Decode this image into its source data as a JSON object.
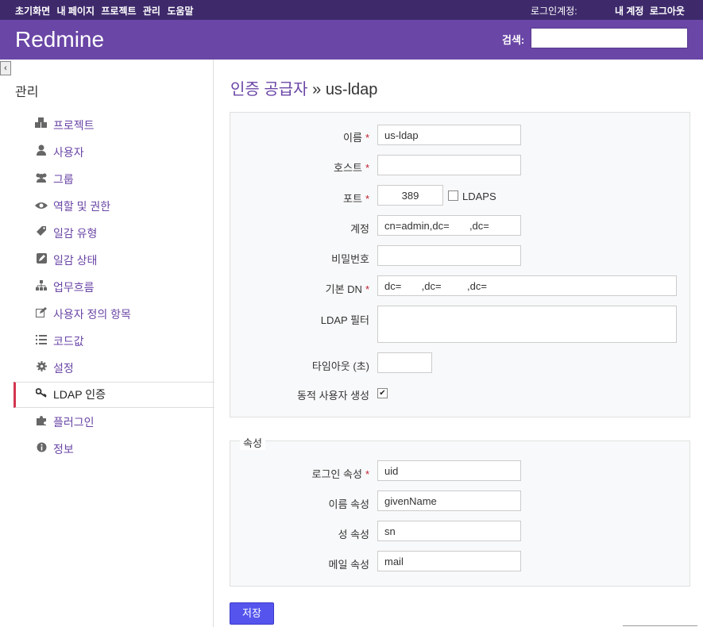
{
  "top_menu": {
    "items": [
      "초기화면",
      "내 페이지",
      "프로젝트",
      "관리",
      "도움말"
    ],
    "logged_in_label": "로그인계정:",
    "account": "내 계정",
    "logout": "로그아웃"
  },
  "header": {
    "title": "Redmine",
    "search_label": "검색:",
    "search_value": ""
  },
  "sidebar": {
    "toggle": "‹",
    "heading": "관리",
    "items": [
      {
        "label": "프로젝트",
        "icon": "projects-icon"
      },
      {
        "label": "사용자",
        "icon": "user-icon"
      },
      {
        "label": "그룹",
        "icon": "group-icon"
      },
      {
        "label": "역할 및 권한",
        "icon": "eye-icon"
      },
      {
        "label": "일감 유형",
        "icon": "tag-icon"
      },
      {
        "label": "일감 상태",
        "icon": "edit-icon"
      },
      {
        "label": "업무흐름",
        "icon": "workflow-icon"
      },
      {
        "label": "사용자 정의 항목",
        "icon": "pencil-square-icon"
      },
      {
        "label": "코드값",
        "icon": "list-icon"
      },
      {
        "label": "설정",
        "icon": "gear-icon"
      },
      {
        "label": "LDAP 인증",
        "icon": "key-icon"
      },
      {
        "label": "플러그인",
        "icon": "puzzle-icon"
      },
      {
        "label": "정보",
        "icon": "info-icon"
      }
    ],
    "selected_index": 10
  },
  "page": {
    "breadcrumb": "인증 공급자",
    "separator": " » ",
    "current": "us-ldap"
  },
  "form": {
    "name_label": "이름",
    "name_value": "us-ldap",
    "host_label": "호스트",
    "host_value": "",
    "port_label": "포트",
    "port_value": "389",
    "ldaps_label": "LDAPS",
    "ldaps_checked": false,
    "account_label": "계정",
    "account_value": "cn=admin,dc=       ,dc=",
    "password_label": "비밀번호",
    "password_value": "",
    "base_dn_label": "기본 DN",
    "base_dn_value": "dc=       ,dc=         ,dc=",
    "filter_label": "LDAP 필터",
    "filter_value": "",
    "timeout_label": "타임아웃 (초)",
    "timeout_value": "",
    "onthefly_label": "동적 사용자 생성",
    "onthefly_checked": true,
    "required_marker": "*"
  },
  "attributes": {
    "legend": "속성",
    "login_label": "로그인 속성",
    "login_value": "uid",
    "firstname_label": "이름 속성",
    "firstname_value": "givenName",
    "lastname_label": "성 속성",
    "lastname_value": "sn",
    "mail_label": "메일 속성",
    "mail_value": "mail"
  },
  "save_button": "저장",
  "colors": {
    "topbar": "#3e2a6b",
    "header": "#6a46a6",
    "link": "#6a46a6",
    "selected_border": "#d3354f",
    "button": "#5555ee",
    "required": "#c02030"
  }
}
